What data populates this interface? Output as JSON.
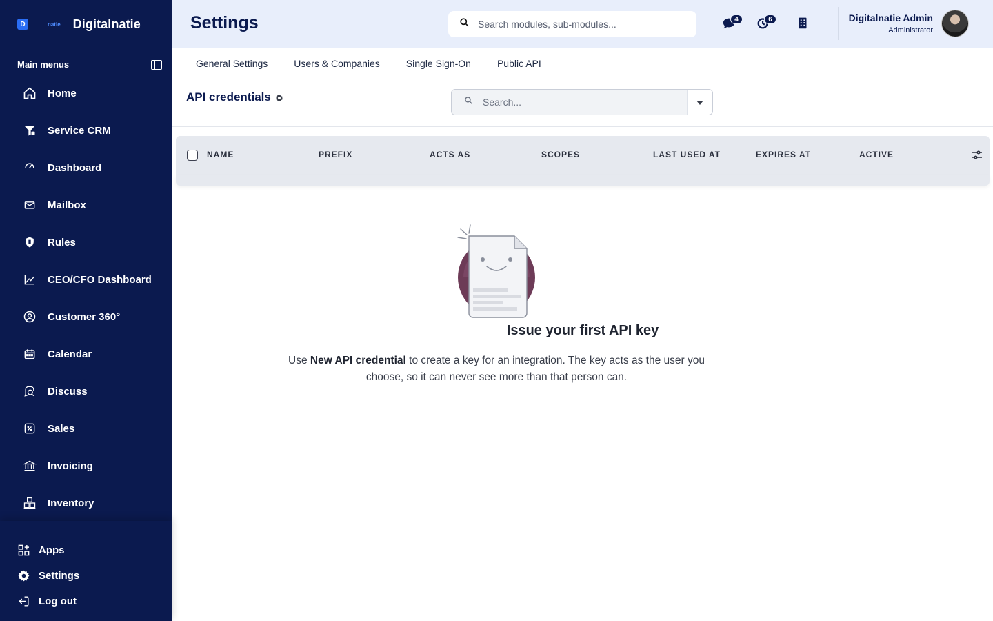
{
  "brand": {
    "logo_letter": "D",
    "small_text": "natie",
    "name": "Digitalnatie"
  },
  "sidebar": {
    "section_label": "Main menus",
    "items": [
      {
        "label": "Home",
        "icon": "home-icon"
      },
      {
        "label": "Service CRM",
        "icon": "filter-icon"
      },
      {
        "label": "Dashboard",
        "icon": "gauge-icon"
      },
      {
        "label": "Mailbox",
        "icon": "mail-icon"
      },
      {
        "label": "Rules",
        "icon": "shield-icon"
      },
      {
        "label": "CEO/CFO Dashboard",
        "icon": "line-chart-icon"
      },
      {
        "label": "Customer 360°",
        "icon": "user-circle-icon"
      },
      {
        "label": "Calendar",
        "icon": "calendar-icon"
      },
      {
        "label": "Discuss",
        "icon": "chat-search-icon"
      },
      {
        "label": "Sales",
        "icon": "percent-icon"
      },
      {
        "label": "Invoicing",
        "icon": "bank-icon"
      },
      {
        "label": "Inventory",
        "icon": "boxes-icon"
      }
    ],
    "bottom": [
      {
        "label": "Apps",
        "icon": "apps-icon"
      },
      {
        "label": "Settings",
        "icon": "gear-icon"
      },
      {
        "label": "Log out",
        "icon": "logout-icon"
      }
    ]
  },
  "topbar": {
    "title": "Settings",
    "search_placeholder": "Search modules, sub-modules...",
    "messages_count": "4",
    "activities_count": "6",
    "user_name": "Digitalnatie Admin",
    "user_role": "Administrator"
  },
  "tabs": [
    "General Settings",
    "Users & Companies",
    "Single Sign-On",
    "Public API"
  ],
  "section": {
    "title": "API credentials",
    "search_placeholder": "Search..."
  },
  "table": {
    "columns": [
      "NAME",
      "PREFIX",
      "ACTS AS",
      "SCOPES",
      "LAST USED AT",
      "EXPIRES AT",
      "ACTIVE"
    ]
  },
  "empty_state": {
    "title": "Issue your first API key",
    "text_before": "Use ",
    "text_bold": "New API credential",
    "text_after": " to create a key for an integration. The key acts as the user you choose, so it can never see more than that person can."
  },
  "colors": {
    "sidebar_bg": "#0b1a4f",
    "topbar_bg": "#e8eefb",
    "table_header_bg": "#e6e9ef",
    "illustration_accent": "#6d3b57"
  }
}
